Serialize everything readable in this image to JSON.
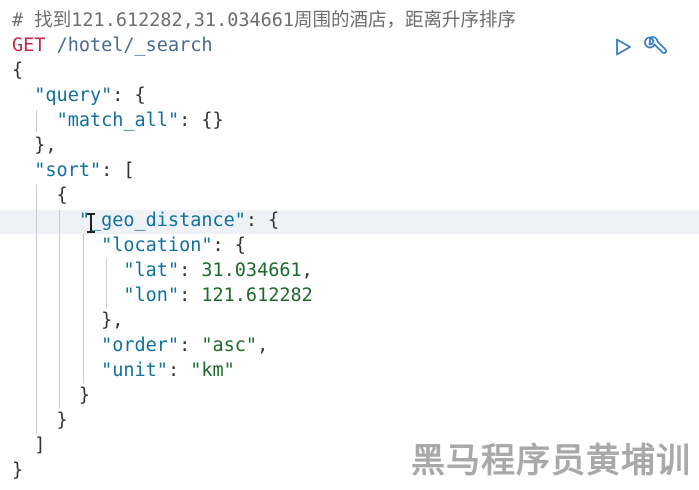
{
  "editor": {
    "comment": "# 找到121.612282,31.034661周围的酒店，距离升序排序",
    "request": {
      "method": "GET",
      "path": "/hotel/_search"
    },
    "query_key": "\"query\"",
    "match_all_key": "\"match_all\"",
    "sort_key": "\"sort\"",
    "geo_distance_key": "\"_geo_distance\"",
    "location_key": "\"location\"",
    "lat_key": "\"lat\"",
    "lat_value": "31.034661",
    "lon_key": "\"lon\"",
    "lon_value": "121.612282",
    "order_key": "\"order\"",
    "order_value": "\"asc\"",
    "unit_key": "\"unit\"",
    "unit_value": "\"km\""
  },
  "toolbar": {
    "run_icon": "play-icon",
    "settings_icon": "wrench-icon",
    "accent": "#3a7ec3"
  },
  "watermark": {
    "text": "黑马程序员黄埔训"
  }
}
